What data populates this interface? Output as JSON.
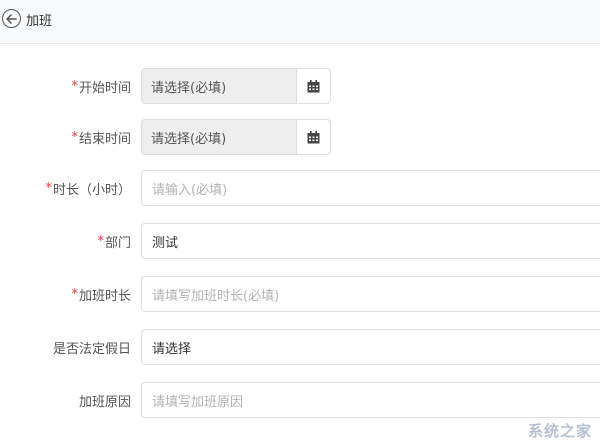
{
  "header": {
    "title": "加班"
  },
  "form": {
    "start_time": {
      "label": "开始时间",
      "value": "请选择(必填)"
    },
    "end_time": {
      "label": "结束时间",
      "value": "请选择(必填)"
    },
    "duration": {
      "label": "时长（小时）",
      "placeholder": "请输入(必填)"
    },
    "department": {
      "label": "部门",
      "value": "测试"
    },
    "ot_hours": {
      "label": "加班时长",
      "placeholder": "请填写加班时长(必填)"
    },
    "holiday": {
      "label": "是否法定假日",
      "value": "请选择"
    },
    "reason": {
      "label": "加班原因",
      "placeholder": "请填写加班原因"
    }
  },
  "required_mark": "*",
  "watermark": "系统之家",
  "colors": {
    "required": "#e4393c",
    "header_bg": "#f8f9fb",
    "date_bg": "#eeeeee"
  },
  "icons": {
    "back": "back-arrow-circle-icon",
    "calendar": "calendar-icon"
  }
}
